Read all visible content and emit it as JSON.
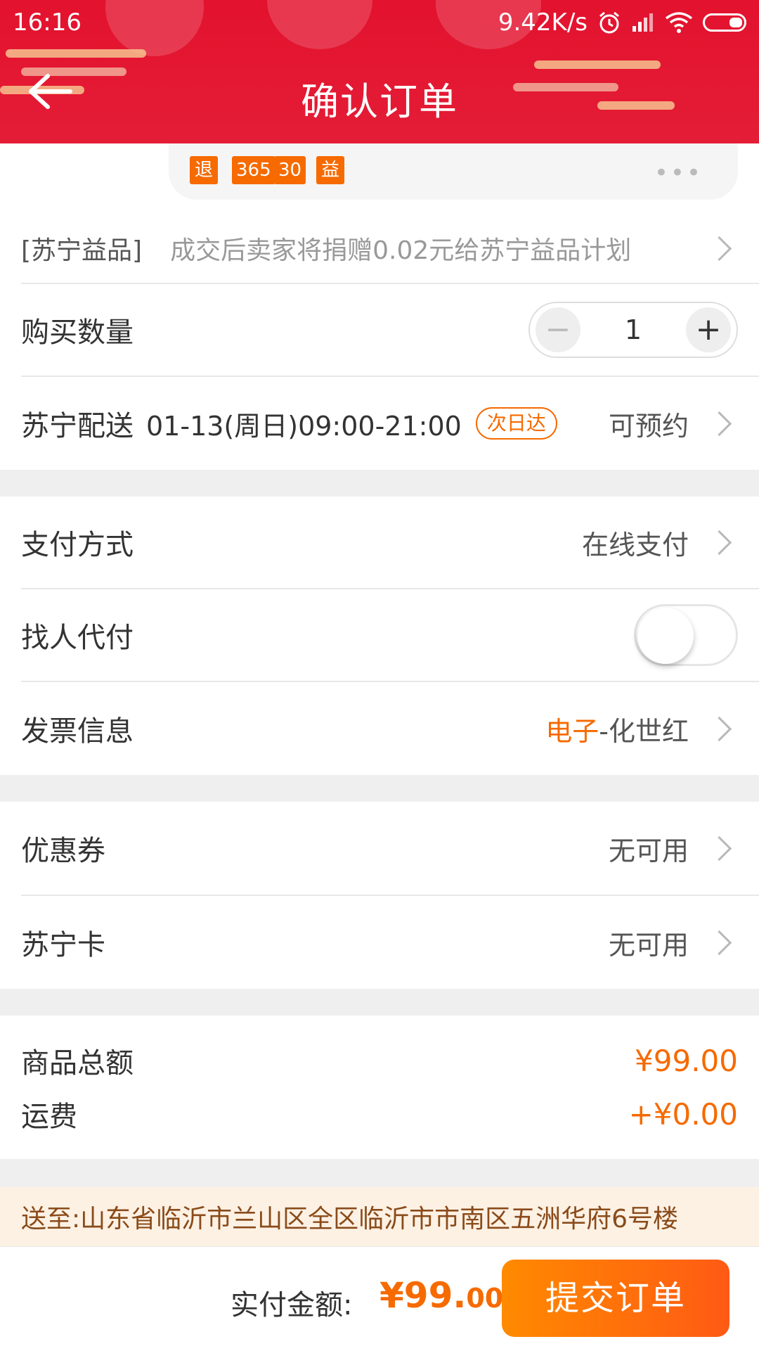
{
  "status_bar": {
    "time": "16:16",
    "network_speed": "9.42K/s",
    "icons": [
      "alarm-icon",
      "signal-icon",
      "wifi-icon",
      "battery-icon"
    ]
  },
  "header": {
    "title": "确认订单",
    "back_icon": "back-arrow-icon",
    "accent_color": "#e3122e"
  },
  "service_tags": [
    "退",
    "365",
    "30",
    "益"
  ],
  "donation": {
    "label": "[苏宁益品]",
    "text": "成交后卖家将捐赠0.02元给苏宁益品计划"
  },
  "quantity": {
    "label": "购买数量",
    "value": "1",
    "minus": "−",
    "plus": "+"
  },
  "delivery": {
    "label": "苏宁配送",
    "date": "01-13(周日)09:00-21:00",
    "badge": "次日达",
    "value": "可预约"
  },
  "payment": {
    "method_label": "支付方式",
    "method_value": "在线支付",
    "proxy_label": "找人代付",
    "proxy_enabled": false,
    "invoice_label": "发票信息",
    "invoice_type": "电子",
    "invoice_name": "-化世红"
  },
  "discounts": {
    "coupon_label": "优惠券",
    "coupon_value": "无可用",
    "card_label": "苏宁卡",
    "card_value": "无可用"
  },
  "totals": {
    "goods_label": "商品总额",
    "goods_amount": "¥99.00",
    "shipping_label": "运费",
    "shipping_amount": "+¥0.00"
  },
  "address": "送至:山东省临沂市兰山区全区临沂市市南区五洲华府6号楼",
  "footer": {
    "pay_label": "实付金额:",
    "pay_integer": "¥99.",
    "pay_decimal": "00",
    "submit_label": "提交订单",
    "accent_color": "#f66a00"
  }
}
